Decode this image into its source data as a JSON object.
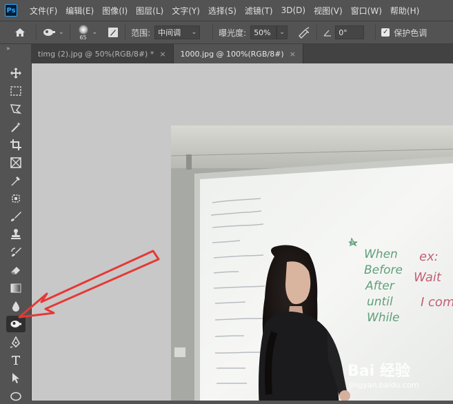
{
  "app": {
    "logo_text": "Ps"
  },
  "menu": [
    "文件(F)",
    "编辑(E)",
    "图像(I)",
    "图层(L)",
    "文字(Y)",
    "选择(S)",
    "滤镜(T)",
    "3D(D)",
    "视图(V)",
    "窗口(W)",
    "帮助(H)"
  ],
  "options": {
    "brush_size": "65",
    "range_label": "范围:",
    "range_value": "中间调",
    "exposure_label": "曝光度:",
    "exposure_value": "50%",
    "angle_value": "0°",
    "protect_tones_label": "保护色调",
    "protect_tones_checked": true
  },
  "tabs": [
    {
      "label": "timg (2).jpg @ 50%(RGB/8#) *",
      "close": "×",
      "active": false
    },
    {
      "label": "1000.jpg @ 100%(RGB/8#)",
      "close": "×",
      "active": true
    }
  ],
  "toolbar": {
    "collapse": "»",
    "active_tool": "dodge-tool"
  },
  "whiteboard": {
    "lines_green": [
      "When",
      "Before",
      "After",
      "until",
      "While"
    ],
    "lines_red": [
      "ex:",
      "Wait",
      "I com"
    ]
  },
  "watermark": {
    "brand": "Bai 经验",
    "url": "jingyan.baidu.com"
  },
  "colors": {
    "accent_red": "#e53935",
    "ps_blue": "#31a8ff"
  }
}
